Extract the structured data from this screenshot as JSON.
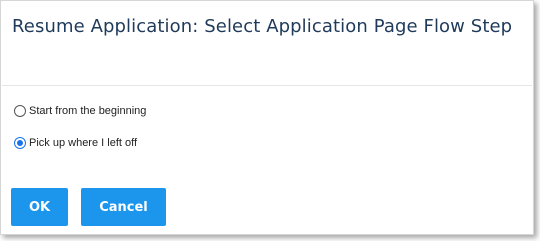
{
  "dialog": {
    "title": "Resume Application: Select Application Page Flow Step",
    "options": [
      {
        "label": "Start from the beginning",
        "checked": false
      },
      {
        "label": "Pick up where I left off",
        "checked": true
      }
    ],
    "buttons": {
      "ok_label": "OK",
      "cancel_label": "Cancel"
    }
  },
  "colors": {
    "title": "#1f3a5a",
    "button": "#1c95ec",
    "radio_selected": "#1a73e8"
  }
}
